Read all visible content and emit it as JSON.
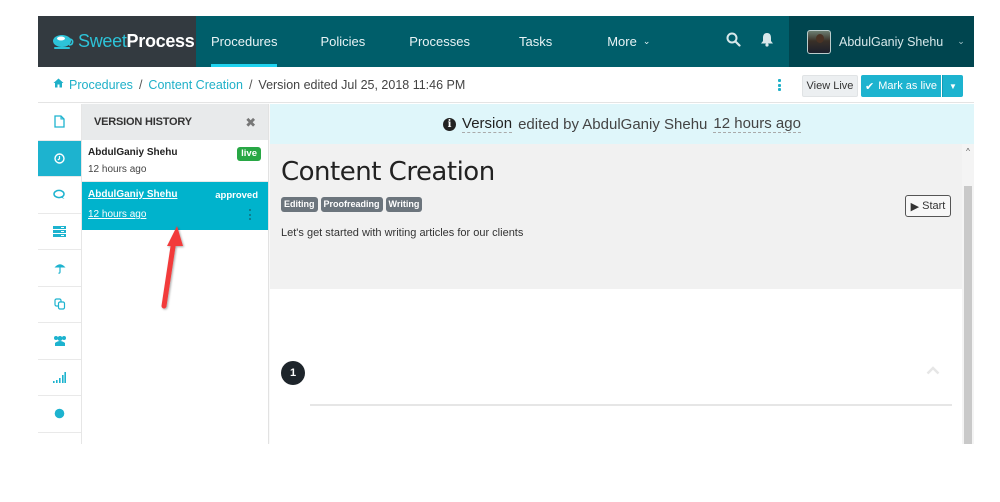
{
  "brand": {
    "name_part1": "Sweet",
    "name_part2": "Process",
    "accent": "#2dc3d8"
  },
  "nav": {
    "items": [
      {
        "label": "Procedures",
        "active": true
      },
      {
        "label": "Policies"
      },
      {
        "label": "Processes"
      },
      {
        "label": "Tasks"
      },
      {
        "label": "More"
      }
    ],
    "more_chevron": "⌄",
    "search_icon": "search-icon",
    "bell_icon": "bell-icon",
    "user": {
      "name": "AbdulGaniy Shehu",
      "chevron": "⌄"
    }
  },
  "breadcrumb": {
    "home_icon": "home-icon",
    "items": [
      "Procedures",
      "Content Creation"
    ],
    "current": "Version edited Jul 25, 2018 11:46 PM",
    "separator": "/"
  },
  "toolbar": {
    "view_live": "View Live",
    "mark_as_live": "Mark as live",
    "check_icon": "✔",
    "caret": "▼"
  },
  "iconbar": {
    "items": [
      {
        "icon": "document-icon"
      },
      {
        "icon": "clock-icon",
        "active": true
      },
      {
        "icon": "comments-icon"
      },
      {
        "icon": "list-icon"
      },
      {
        "icon": "umbrella-icon"
      },
      {
        "icon": "copy-icon"
      },
      {
        "icon": "users-icon"
      },
      {
        "icon": "signal-icon"
      },
      {
        "icon": "gear-icon"
      }
    ]
  },
  "version_history": {
    "title": "VERSION HISTORY",
    "close": "✖",
    "items": [
      {
        "author": "AbdulGaniy Shehu",
        "time": "12 hours ago",
        "badge": "live"
      },
      {
        "author": "AbdulGaniy Shehu",
        "time": "12 hours ago",
        "status": "approved",
        "selected": true
      }
    ]
  },
  "banner": {
    "info_icon": "i",
    "version_word": "Version",
    "edited_by": "edited by AbdulGaniy Shehu",
    "time_ago": "12 hours ago"
  },
  "procedure": {
    "title": "Content Creation",
    "tags": [
      "Editing",
      "Proofreading",
      "Writing"
    ],
    "description": "Let's get started with writing articles for our clients",
    "start_label": "Start",
    "start_icon": "▶"
  },
  "steps": [
    {
      "number": "1",
      "collapse_icon": "^"
    }
  ],
  "scrollbar": {
    "up_arrow": "^"
  },
  "annotation": {
    "color": "#f23b3b"
  }
}
